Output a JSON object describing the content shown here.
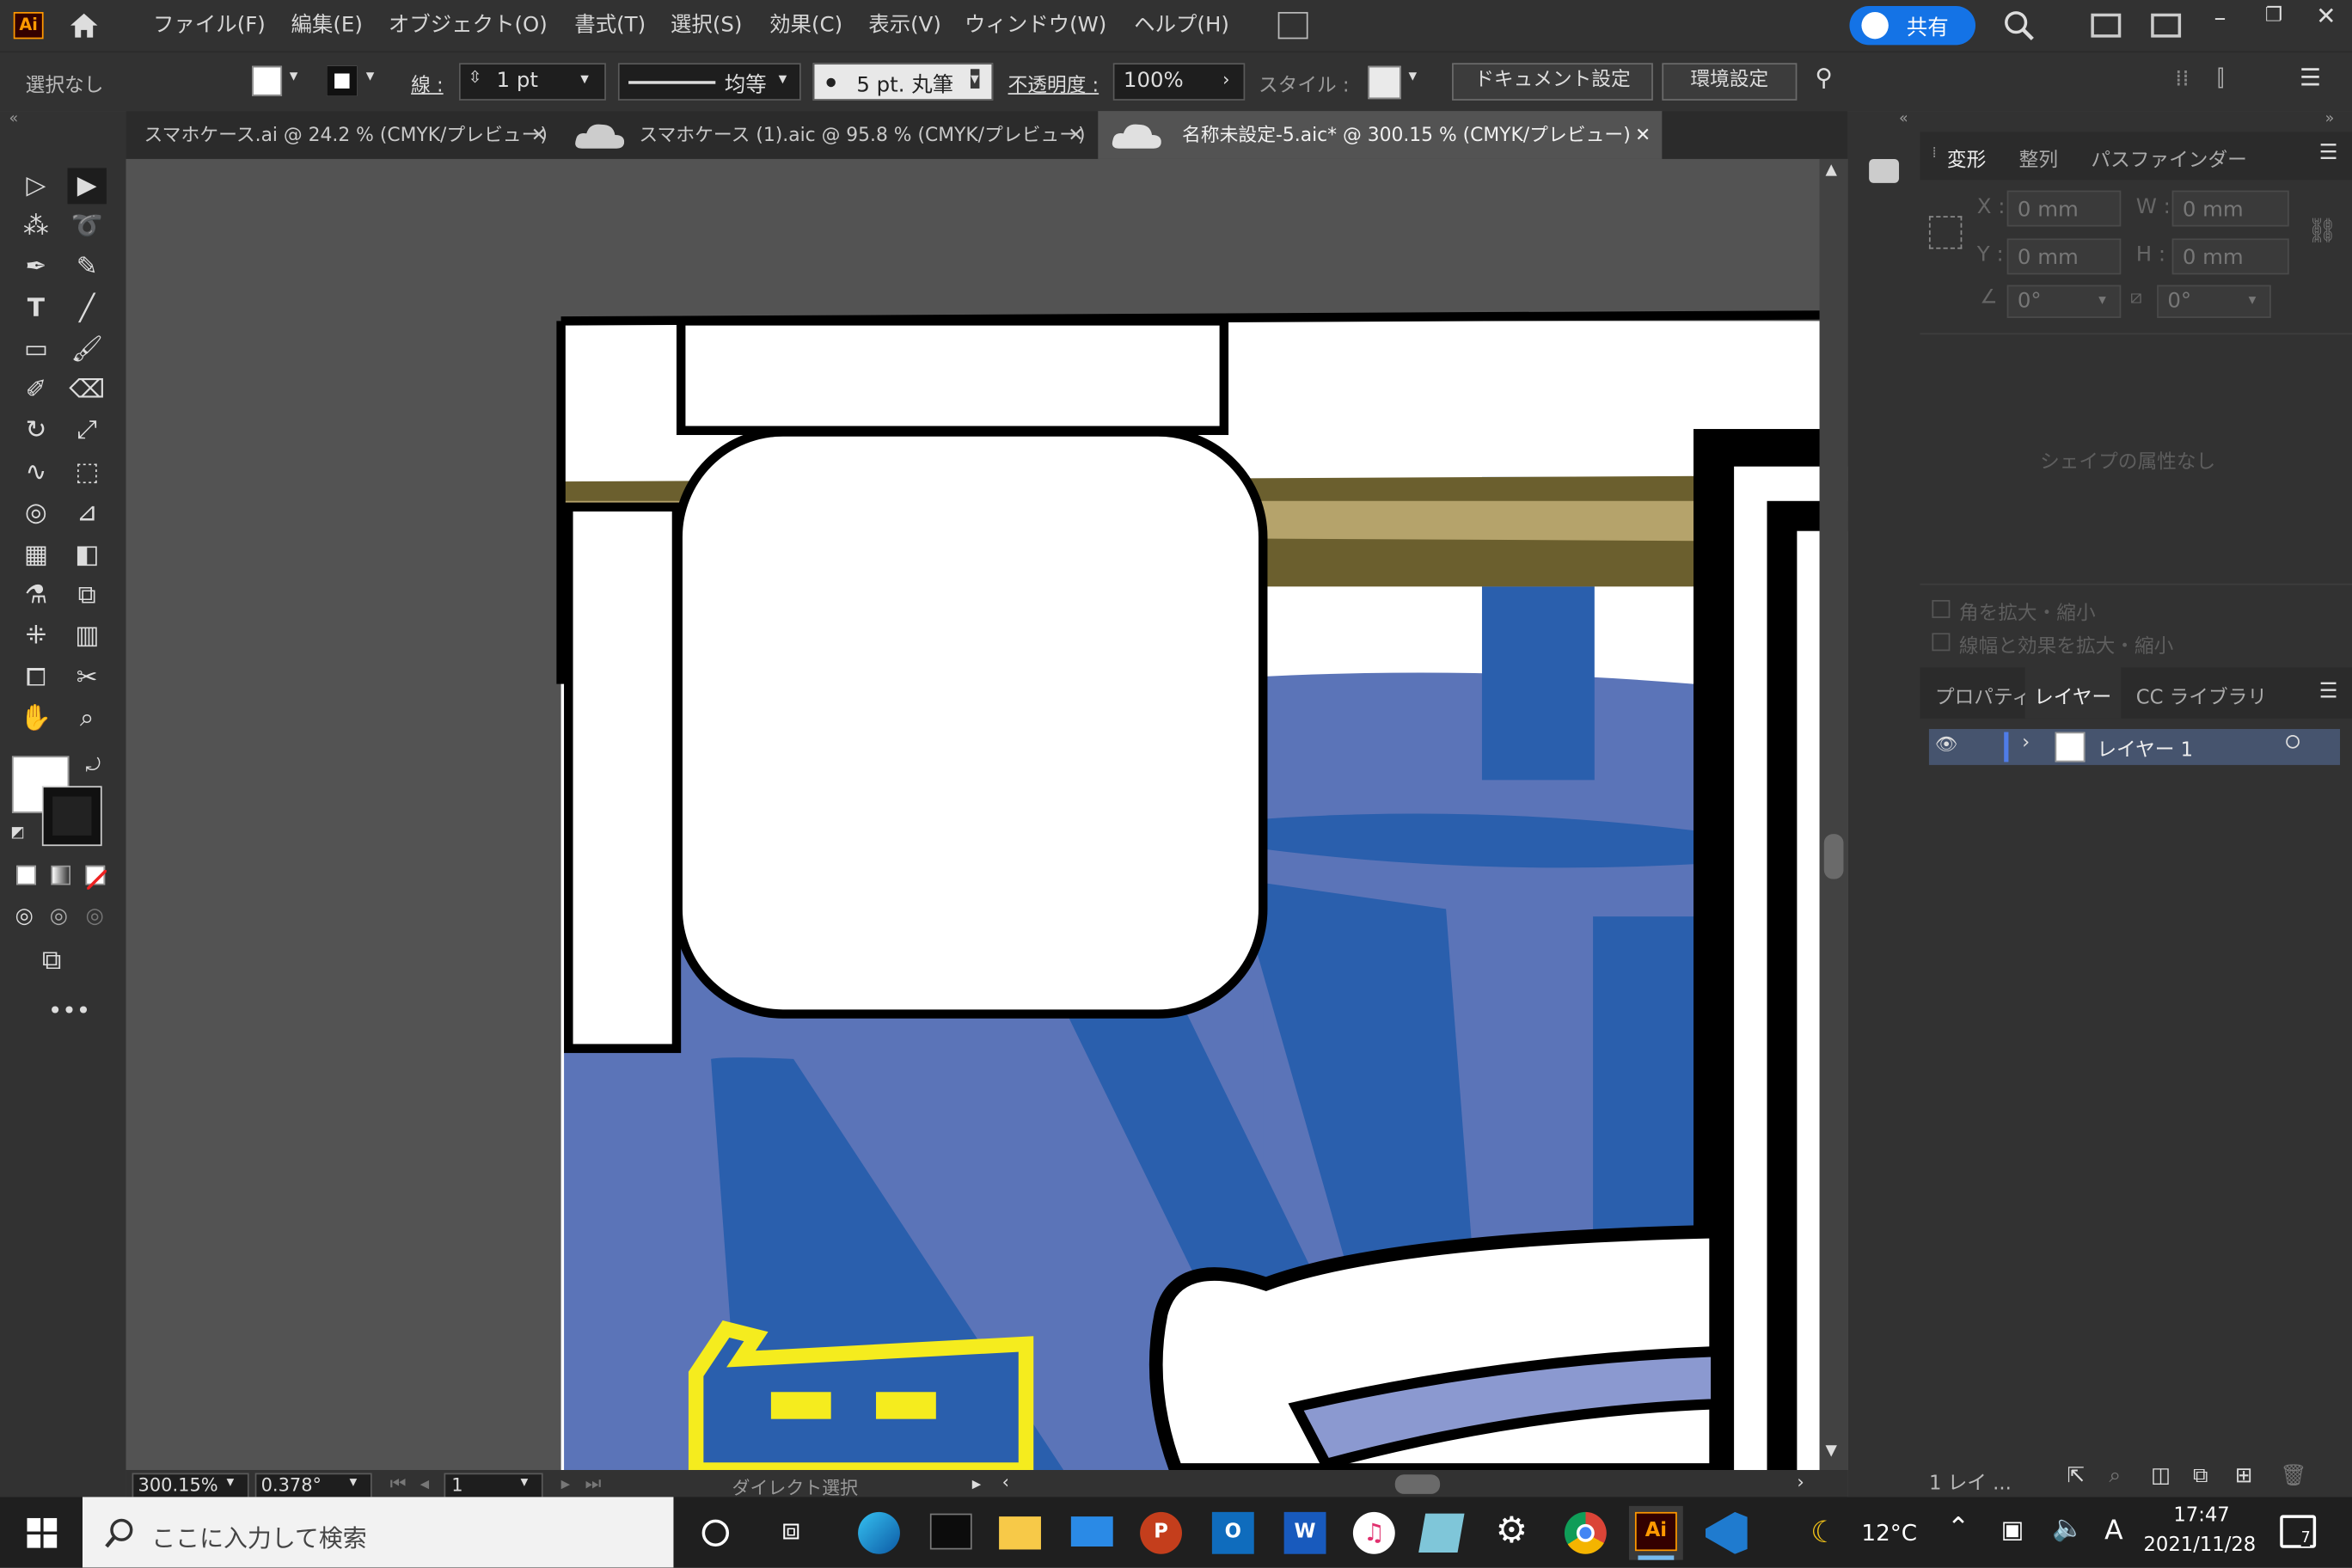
{
  "menubar": {
    "app_logo": "Ai",
    "items": [
      "ファイル(F)",
      "編集(E)",
      "オブジェクト(O)",
      "書式(T)",
      "選択(S)",
      "効果(C)",
      "表示(V)",
      "ウィンドウ(W)",
      "ヘルプ(H)"
    ],
    "share_label": "共有"
  },
  "control": {
    "selection": "選択なし",
    "stroke_label": "線 :",
    "stroke_weight": "1 pt",
    "stroke_profile": "均等",
    "brush": "5 pt. 丸筆",
    "opacity_label": "不透明度 :",
    "opacity_value": "100%",
    "style_label": "スタイル :",
    "doc_settings": "ドキュメント設定",
    "preferences": "環境設定"
  },
  "tabs": [
    {
      "label": "スマホケース.ai @ 24.2 % (CMYK/プレビュー)"
    },
    {
      "label": "スマホケース (1).aic @ 95.8 % (CMYK/プレビュー)"
    },
    {
      "label": "名称未設定-5.aic* @ 300.15 % (CMYK/プレビュー)"
    }
  ],
  "statusbar": {
    "zoom": "300.15%",
    "rotation": "0.378°",
    "artboard": "1",
    "tool": "ダイレクト選択"
  },
  "transform_panel": {
    "tabs": [
      "変形",
      "整列",
      "パスファインダー"
    ],
    "x_label": "X :",
    "x_value": "0 mm",
    "y_label": "Y :",
    "y_value": "0 mm",
    "w_label": "W :",
    "w_value": "0 mm",
    "h_label": "H :",
    "h_value": "0 mm",
    "angle": "0°",
    "shear": "0°",
    "no_attributes": "シェイプの属性なし",
    "scale_corners": "角を拡大・縮小",
    "scale_strokes": "線幅と効果を拡大・縮小"
  },
  "layers_panel": {
    "tabs": [
      "プロパティ",
      "レイヤー",
      "CC ライブラリ"
    ],
    "layer_name": "レイヤー 1",
    "footer_count": "1 レイ ..."
  },
  "taskbar": {
    "search_placeholder": "ここに入力して検索",
    "temperature": "12°C",
    "ime": "A",
    "time": "17:47",
    "date": "2021/11/28",
    "notifications": "7"
  },
  "colors": {
    "accent": "#1473e6",
    "canvas_blue": "#5b74b8",
    "dark_blue": "#2a5fad",
    "olive": "#6b5f2e",
    "khaki": "#b5a36b",
    "yellow": "#f5ec1e"
  }
}
